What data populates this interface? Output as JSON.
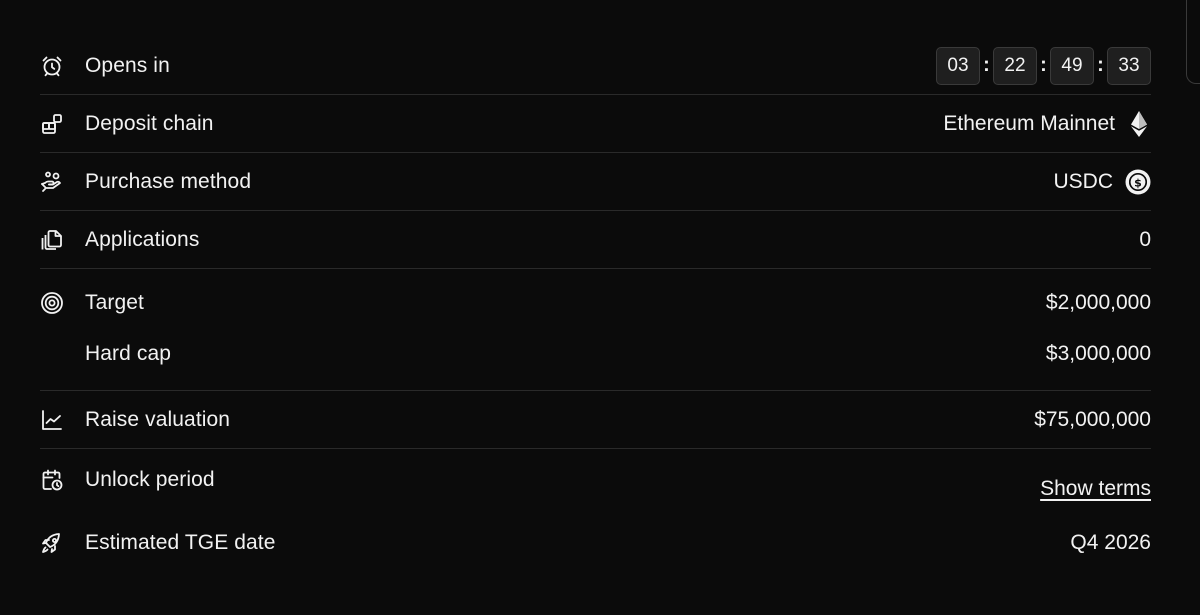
{
  "rows": {
    "opens_in": {
      "label": "Opens in",
      "countdown": [
        "03",
        "22",
        "49",
        "33"
      ]
    },
    "deposit_chain": {
      "label": "Deposit chain",
      "value": "Ethereum Mainnet",
      "icon": "ethereum-icon"
    },
    "purchase_method": {
      "label": "Purchase method",
      "value": "USDC",
      "icon": "usdc-icon"
    },
    "applications": {
      "label": "Applications",
      "value": "0"
    },
    "target": {
      "label": "Target",
      "value": "$2,000,000"
    },
    "hard_cap": {
      "label": "Hard cap",
      "value": "$3,000,000"
    },
    "raise_valuation": {
      "label": "Raise valuation",
      "value": "$75,000,000"
    },
    "unlock_period": {
      "label": "Unlock period",
      "value": "Show terms"
    },
    "tge_date": {
      "label": "Estimated TGE date",
      "value": "Q4 2026"
    }
  },
  "colors": {
    "background": "#0b0b0b",
    "text": "#f2f2f2",
    "divider": "#2a2a2a",
    "countdown_box": "#1f1f1f"
  }
}
